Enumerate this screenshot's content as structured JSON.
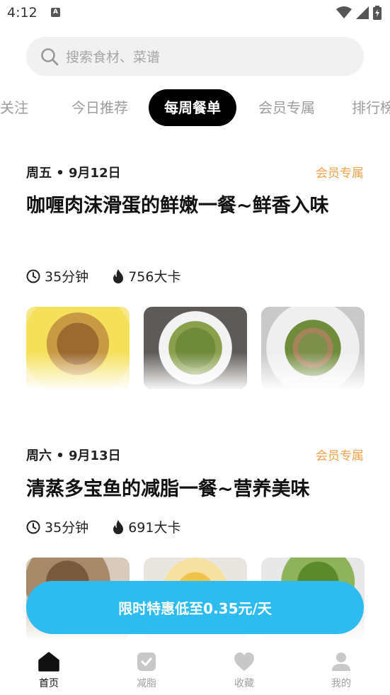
{
  "status_bar": {
    "time": "4:12",
    "notif_letter": "A"
  },
  "search": {
    "placeholder": "搜索食材、菜谱"
  },
  "tabs": [
    {
      "label": "关注"
    },
    {
      "label": "今日推荐"
    },
    {
      "label": "每周餐单",
      "active": true
    },
    {
      "label": "会员专属"
    },
    {
      "label": "排行榜"
    }
  ],
  "meals": [
    {
      "date": "周五 • 9月12日",
      "badge": "会员专属",
      "title": "咖喱肉沫滑蛋的鲜嫩一餐~鲜香入味",
      "time": "35分钟",
      "calories": "756大卡"
    },
    {
      "date": "周六 • 9月13日",
      "badge": "会员专属",
      "title": "清蒸多宝鱼的减脂一餐~营养美味",
      "time": "35分钟",
      "calories": "691大卡"
    }
  ],
  "promo": {
    "label": "限时特惠低至0.35元/天"
  },
  "bottom_nav": [
    {
      "label": "首页",
      "icon": "home-icon",
      "active": true
    },
    {
      "label": "减脂",
      "icon": "shield-check-icon"
    },
    {
      "label": "收藏",
      "icon": "heart-icon"
    },
    {
      "label": "我的",
      "icon": "user-icon"
    }
  ],
  "colors": {
    "accent": "#2ebcf0",
    "badge": "#f0a24a",
    "active_tab": "#000000"
  }
}
